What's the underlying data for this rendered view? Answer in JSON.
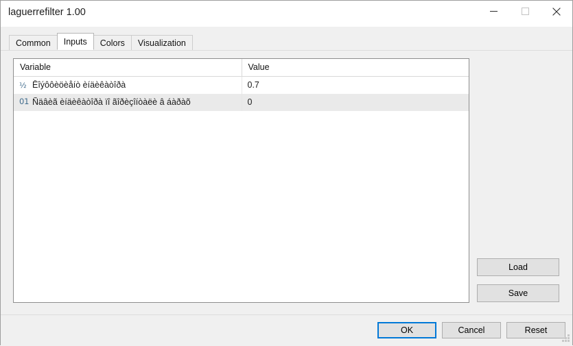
{
  "window": {
    "title": "laguerrefilter 1.00",
    "ghost_text": "…………",
    "ghost_text2": "……",
    "controls": [
      {
        "name": "minimize",
        "glyph": "minimize-icon"
      },
      {
        "name": "maximize",
        "glyph": "maximize-icon"
      },
      {
        "name": "close",
        "glyph": "close-icon"
      }
    ]
  },
  "tabs": [
    {
      "label": "Common",
      "active": false
    },
    {
      "label": "Inputs",
      "active": true
    },
    {
      "label": "Colors",
      "active": false
    },
    {
      "label": "Visualization",
      "active": false
    }
  ],
  "table": {
    "columns": [
      "Variable",
      "Value"
    ],
    "rows": [
      {
        "type_icon": "½",
        "type_icon_name": "double-type-icon",
        "variable": "Êîýôôèöèåíò èíäèêàòîðà",
        "value": "0.7"
      },
      {
        "type_icon": "01",
        "type_icon_name": "integer-type-icon",
        "variable": "Ñäâèã èíäèêàòîðà ïî ãîðèçîíòàëè â áàðàõ",
        "value": "0"
      }
    ]
  },
  "side_buttons": {
    "load": "Load",
    "save": "Save"
  },
  "footer_buttons": {
    "ok": "OK",
    "cancel": "Cancel",
    "reset": "Reset"
  },
  "colors": {
    "focus_accent": "#0078d7",
    "type_icon": "#3f6b8c",
    "window_bg": "#f0f0f0",
    "row_alt": "#eaeaea"
  }
}
